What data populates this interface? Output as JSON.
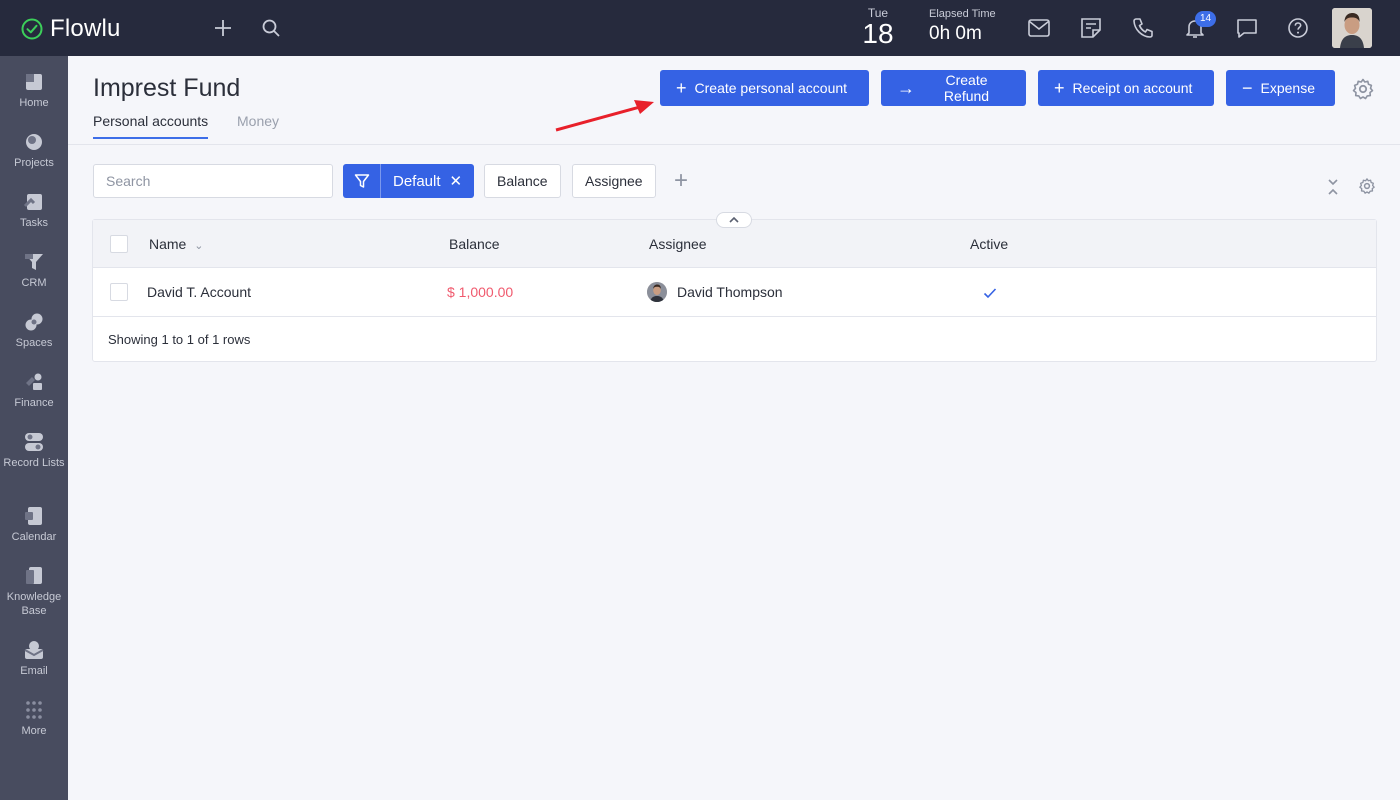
{
  "app": {
    "name": "Flowlu",
    "date_dow": "Tue",
    "date_day": "18",
    "elapsed_label": "Elapsed Time",
    "elapsed_value": "0h 0m",
    "notification_count": "14"
  },
  "sidebar": {
    "items": [
      {
        "label": "Home",
        "icon": "home-icon"
      },
      {
        "label": "Projects",
        "icon": "projects-icon"
      },
      {
        "label": "Tasks",
        "icon": "tasks-icon"
      },
      {
        "label": "CRM",
        "icon": "crm-icon"
      },
      {
        "label": "Spaces",
        "icon": "spaces-icon"
      },
      {
        "label": "Finance",
        "icon": "finance-icon"
      },
      {
        "label": "Record Lists",
        "icon": "record-lists-icon"
      },
      {
        "label": "Calendar",
        "icon": "calendar-icon"
      },
      {
        "label": "Knowledge Base",
        "icon": "knowledge-base-icon"
      },
      {
        "label": "Email",
        "icon": "email-icon"
      },
      {
        "label": "More",
        "icon": "more-icon"
      }
    ]
  },
  "page": {
    "title": "Imprest Fund",
    "tabs": [
      {
        "label": "Personal accounts",
        "active": true
      },
      {
        "label": "Money",
        "active": false
      }
    ],
    "actions": {
      "create_personal_account": "Create personal account",
      "create_refund": "Create Refund",
      "receipt_on_account": "Receipt on account",
      "expense": "Expense"
    }
  },
  "filters": {
    "search_placeholder": "Search",
    "active_filter": "Default",
    "pills": [
      "Balance",
      "Assignee"
    ]
  },
  "table": {
    "columns": [
      "Name",
      "Balance",
      "Assignee",
      "Active"
    ],
    "rows": [
      {
        "name": "David T. Account",
        "balance": "$ 1,000.00",
        "assignee": "David Thompson",
        "active": true
      }
    ],
    "footer": "Showing 1 to 1 of 1 rows"
  },
  "colors": {
    "topbar": "#262a3d",
    "sidebar": "#484c5f",
    "accent": "#3562e4",
    "balance": "#f05a6e",
    "annotation_arrow": "#e8202a"
  }
}
